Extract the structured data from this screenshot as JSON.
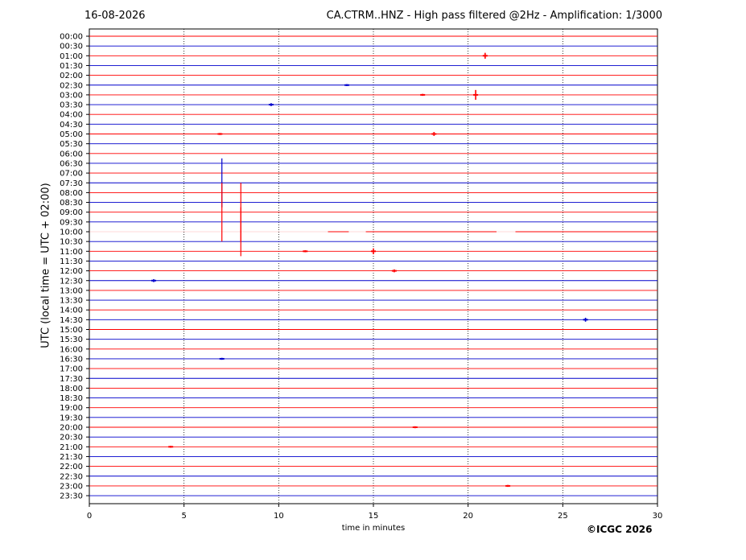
{
  "header": {
    "date": "16-08-2026",
    "title": "CA.CTRM..HNZ - High pass filtered @2Hz - Amplification: 1/3000"
  },
  "footer": {
    "copyright": "©ICGC 2026"
  },
  "colors": {
    "trace_red": "#ff0000",
    "trace_blue": "#0000cc",
    "grid": "#000000"
  },
  "chart_data": {
    "type": "line",
    "title": "CA.CTRM..HNZ - High pass filtered @2Hz - Amplification: 1/3000",
    "xlabel": "time in minutes",
    "ylabel": "UTC (local time = UTC + 02:00)",
    "xlim": [
      0,
      30
    ],
    "xticks": [
      0,
      5,
      10,
      15,
      20,
      25,
      30
    ],
    "grid": "vertical dotted at 5-minute intervals",
    "rows": [
      "00:00",
      "00:30",
      "01:00",
      "01:30",
      "02:00",
      "02:30",
      "03:00",
      "03:30",
      "04:00",
      "04:30",
      "05:00",
      "05:30",
      "06:00",
      "06:30",
      "07:00",
      "07:30",
      "08:00",
      "08:30",
      "09:00",
      "09:30",
      "10:00",
      "10:30",
      "11:00",
      "11:30",
      "12:00",
      "12:30",
      "13:00",
      "13:30",
      "14:00",
      "14:30",
      "15:00",
      "15:30",
      "16:00",
      "16:30",
      "17:00",
      "17:30",
      "18:00",
      "18:30",
      "19:00",
      "19:30",
      "20:00",
      "20:30",
      "21:00",
      "21:30",
      "22:00",
      "22:30",
      "23:00",
      "23:30"
    ],
    "row_colors": "alternating red / blue, starting red at 00:00",
    "events": [
      {
        "row": "01:00",
        "minute": 20.9,
        "amplitude": 0.3
      },
      {
        "row": "02:30",
        "minute": 13.6,
        "amplitude": 0.1
      },
      {
        "row": "03:00",
        "minute": 20.4,
        "amplitude": 0.5
      },
      {
        "row": "03:00",
        "minute": 17.6,
        "amplitude": 0.1
      },
      {
        "row": "03:30",
        "minute": 9.6,
        "amplitude": 0.15
      },
      {
        "row": "05:00",
        "minute": 18.2,
        "amplitude": 0.2
      },
      {
        "row": "05:00",
        "minute": 6.9,
        "amplitude": 0.1
      },
      {
        "row": "07:30",
        "minute": 7.0,
        "amplitude": 2.5
      },
      {
        "row": "09:00",
        "minute": 7.0,
        "amplitude": 3.0
      },
      {
        "row": "09:00",
        "minute": 8.0,
        "amplitude": 3.0
      },
      {
        "row": "10:00",
        "minute": 8.0,
        "amplitude": 2.5
      },
      {
        "row": "11:00",
        "minute": 15.0,
        "amplitude": 0.3
      },
      {
        "row": "11:00",
        "minute": 11.4,
        "amplitude": 0.1
      },
      {
        "row": "12:00",
        "minute": 16.1,
        "amplitude": 0.15
      },
      {
        "row": "12:30",
        "minute": 3.4,
        "amplitude": 0.15
      },
      {
        "row": "14:30",
        "minute": 26.2,
        "amplitude": 0.2
      },
      {
        "row": "16:30",
        "minute": 7.0,
        "amplitude": 0.1
      },
      {
        "row": "20:00",
        "minute": 17.2,
        "amplitude": 0.1
      },
      {
        "row": "21:00",
        "minute": 4.3,
        "amplitude": 0.1
      },
      {
        "row": "23:00",
        "minute": 22.1,
        "amplitude": 0.1
      }
    ],
    "gaps": [
      {
        "row": "10:00",
        "minute_start": 0.0,
        "minute_end": 12.6
      },
      {
        "row": "10:00",
        "minute_start": 13.7,
        "minute_end": 14.6
      },
      {
        "row": "10:00",
        "minute_start": 21.5,
        "minute_end": 22.5
      }
    ]
  }
}
